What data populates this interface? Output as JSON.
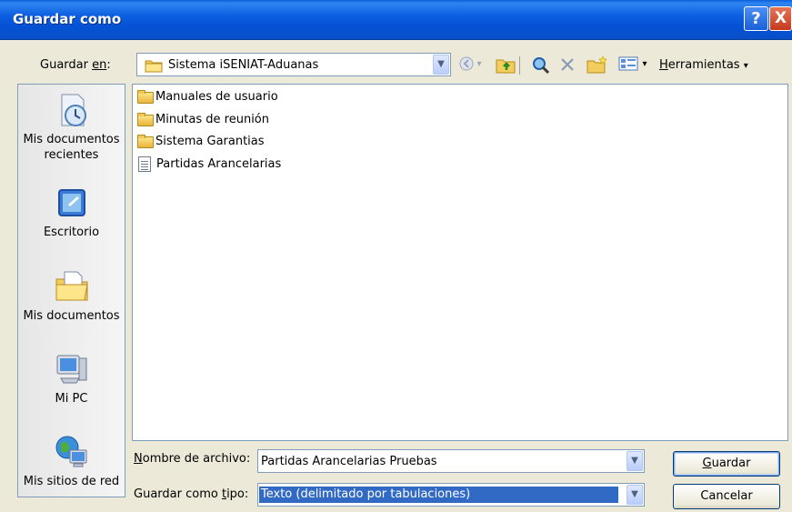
{
  "window": {
    "title": "Guardar como",
    "help_label": "?",
    "close_label": "X"
  },
  "location": {
    "label_prefix": "Guardar ",
    "label_key": "en",
    "label_suffix": ":",
    "current_folder": "Sistema iSENIAT-Aduanas",
    "tools_prefix": "",
    "tools_key": "H",
    "tools_suffix": "erramientas",
    "tools_arrow": "▾"
  },
  "places": [
    {
      "label": "Mis documentos recientes",
      "icon": "recent-documents-icon"
    },
    {
      "label": "Escritorio",
      "icon": "desktop-icon"
    },
    {
      "label": "Mis documentos",
      "icon": "my-documents-icon"
    },
    {
      "label": "Mi PC",
      "icon": "my-computer-icon"
    },
    {
      "label": "Mis sitios de red",
      "icon": "network-places-icon"
    }
  ],
  "files": [
    {
      "name": "Manuales de usuario",
      "type": "folder"
    },
    {
      "name": "Minutas de reunión",
      "type": "folder"
    },
    {
      "name": "Sistema Garantias",
      "type": "folder"
    },
    {
      "name": "Partidas Arancelarias",
      "type": "document"
    }
  ],
  "filename": {
    "label_key": "N",
    "label_rest": "ombre de archivo:",
    "value": "Partidas Arancelarias Pruebas"
  },
  "filetype": {
    "label_prefix": "Guardar como ",
    "label_key": "t",
    "label_suffix": "ipo:",
    "value": "Texto (delimitado por tabulaciones)"
  },
  "buttons": {
    "save_key": "G",
    "save_rest": "uardar",
    "cancel_label": "Cancelar"
  },
  "colors": {
    "titlebar": "#0452d3",
    "selection": "#316ac5",
    "dialog": "#ece9d8"
  }
}
